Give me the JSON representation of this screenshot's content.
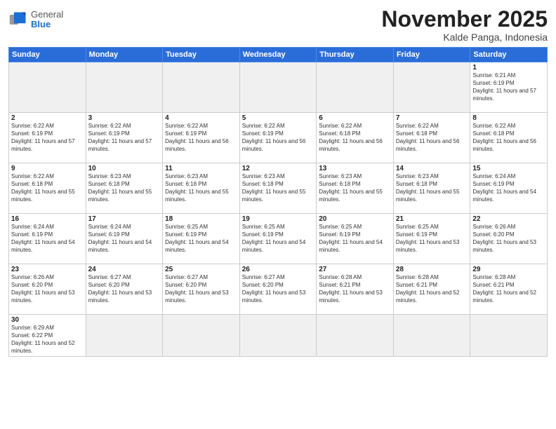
{
  "header": {
    "logo_general": "General",
    "logo_blue": "Blue",
    "month_year": "November 2025",
    "location": "Kalde Panga, Indonesia"
  },
  "weekdays": [
    "Sunday",
    "Monday",
    "Tuesday",
    "Wednesday",
    "Thursday",
    "Friday",
    "Saturday"
  ],
  "weeks": [
    [
      {
        "day": "",
        "empty": true
      },
      {
        "day": "",
        "empty": true
      },
      {
        "day": "",
        "empty": true
      },
      {
        "day": "",
        "empty": true
      },
      {
        "day": "",
        "empty": true
      },
      {
        "day": "",
        "empty": true
      },
      {
        "day": "1",
        "sunrise": "Sunrise: 6:21 AM",
        "sunset": "Sunset: 6:19 PM",
        "daylight": "Daylight: 11 hours and 57 minutes."
      }
    ],
    [
      {
        "day": "2",
        "sunrise": "Sunrise: 6:22 AM",
        "sunset": "Sunset: 6:19 PM",
        "daylight": "Daylight: 11 hours and 57 minutes."
      },
      {
        "day": "3",
        "sunrise": "Sunrise: 6:22 AM",
        "sunset": "Sunset: 6:19 PM",
        "daylight": "Daylight: 11 hours and 57 minutes."
      },
      {
        "day": "4",
        "sunrise": "Sunrise: 6:22 AM",
        "sunset": "Sunset: 6:19 PM",
        "daylight": "Daylight: 11 hours and 56 minutes."
      },
      {
        "day": "5",
        "sunrise": "Sunrise: 6:22 AM",
        "sunset": "Sunset: 6:19 PM",
        "daylight": "Daylight: 11 hours and 56 minutes."
      },
      {
        "day": "6",
        "sunrise": "Sunrise: 6:22 AM",
        "sunset": "Sunset: 6:18 PM",
        "daylight": "Daylight: 11 hours and 56 minutes."
      },
      {
        "day": "7",
        "sunrise": "Sunrise: 6:22 AM",
        "sunset": "Sunset: 6:18 PM",
        "daylight": "Daylight: 11 hours and 56 minutes."
      },
      {
        "day": "8",
        "sunrise": "Sunrise: 6:22 AM",
        "sunset": "Sunset: 6:18 PM",
        "daylight": "Daylight: 11 hours and 56 minutes."
      }
    ],
    [
      {
        "day": "9",
        "sunrise": "Sunrise: 6:22 AM",
        "sunset": "Sunset: 6:18 PM",
        "daylight": "Daylight: 11 hours and 55 minutes."
      },
      {
        "day": "10",
        "sunrise": "Sunrise: 6:23 AM",
        "sunset": "Sunset: 6:18 PM",
        "daylight": "Daylight: 11 hours and 55 minutes."
      },
      {
        "day": "11",
        "sunrise": "Sunrise: 6:23 AM",
        "sunset": "Sunset: 6:18 PM",
        "daylight": "Daylight: 11 hours and 55 minutes."
      },
      {
        "day": "12",
        "sunrise": "Sunrise: 6:23 AM",
        "sunset": "Sunset: 6:18 PM",
        "daylight": "Daylight: 11 hours and 55 minutes."
      },
      {
        "day": "13",
        "sunrise": "Sunrise: 6:23 AM",
        "sunset": "Sunset: 6:18 PM",
        "daylight": "Daylight: 11 hours and 55 minutes."
      },
      {
        "day": "14",
        "sunrise": "Sunrise: 6:23 AM",
        "sunset": "Sunset: 6:18 PM",
        "daylight": "Daylight: 11 hours and 55 minutes."
      },
      {
        "day": "15",
        "sunrise": "Sunrise: 6:24 AM",
        "sunset": "Sunset: 6:19 PM",
        "daylight": "Daylight: 11 hours and 54 minutes."
      }
    ],
    [
      {
        "day": "16",
        "sunrise": "Sunrise: 6:24 AM",
        "sunset": "Sunset: 6:19 PM",
        "daylight": "Daylight: 11 hours and 54 minutes."
      },
      {
        "day": "17",
        "sunrise": "Sunrise: 6:24 AM",
        "sunset": "Sunset: 6:19 PM",
        "daylight": "Daylight: 11 hours and 54 minutes."
      },
      {
        "day": "18",
        "sunrise": "Sunrise: 6:25 AM",
        "sunset": "Sunset: 6:19 PM",
        "daylight": "Daylight: 11 hours and 54 minutes."
      },
      {
        "day": "19",
        "sunrise": "Sunrise: 6:25 AM",
        "sunset": "Sunset: 6:19 PM",
        "daylight": "Daylight: 11 hours and 54 minutes."
      },
      {
        "day": "20",
        "sunrise": "Sunrise: 6:25 AM",
        "sunset": "Sunset: 6:19 PM",
        "daylight": "Daylight: 11 hours and 54 minutes."
      },
      {
        "day": "21",
        "sunrise": "Sunrise: 6:25 AM",
        "sunset": "Sunset: 6:19 PM",
        "daylight": "Daylight: 11 hours and 53 minutes."
      },
      {
        "day": "22",
        "sunrise": "Sunrise: 6:26 AM",
        "sunset": "Sunset: 6:20 PM",
        "daylight": "Daylight: 11 hours and 53 minutes."
      }
    ],
    [
      {
        "day": "23",
        "sunrise": "Sunrise: 6:26 AM",
        "sunset": "Sunset: 6:20 PM",
        "daylight": "Daylight: 11 hours and 53 minutes."
      },
      {
        "day": "24",
        "sunrise": "Sunrise: 6:27 AM",
        "sunset": "Sunset: 6:20 PM",
        "daylight": "Daylight: 11 hours and 53 minutes."
      },
      {
        "day": "25",
        "sunrise": "Sunrise: 6:27 AM",
        "sunset": "Sunset: 6:20 PM",
        "daylight": "Daylight: 11 hours and 53 minutes."
      },
      {
        "day": "26",
        "sunrise": "Sunrise: 6:27 AM",
        "sunset": "Sunset: 6:20 PM",
        "daylight": "Daylight: 11 hours and 53 minutes."
      },
      {
        "day": "27",
        "sunrise": "Sunrise: 6:28 AM",
        "sunset": "Sunset: 6:21 PM",
        "daylight": "Daylight: 11 hours and 53 minutes."
      },
      {
        "day": "28",
        "sunrise": "Sunrise: 6:28 AM",
        "sunset": "Sunset: 6:21 PM",
        "daylight": "Daylight: 11 hours and 52 minutes."
      },
      {
        "day": "29",
        "sunrise": "Sunrise: 6:28 AM",
        "sunset": "Sunset: 6:21 PM",
        "daylight": "Daylight: 11 hours and 52 minutes."
      }
    ],
    [
      {
        "day": "30",
        "sunrise": "Sunrise: 6:29 AM",
        "sunset": "Sunset: 6:22 PM",
        "daylight": "Daylight: 11 hours and 52 minutes.",
        "last": true
      },
      {
        "day": "",
        "empty": true,
        "last": true
      },
      {
        "day": "",
        "empty": true,
        "last": true
      },
      {
        "day": "",
        "empty": true,
        "last": true
      },
      {
        "day": "",
        "empty": true,
        "last": true
      },
      {
        "day": "",
        "empty": true,
        "last": true
      },
      {
        "day": "",
        "empty": true,
        "last": true
      }
    ]
  ]
}
